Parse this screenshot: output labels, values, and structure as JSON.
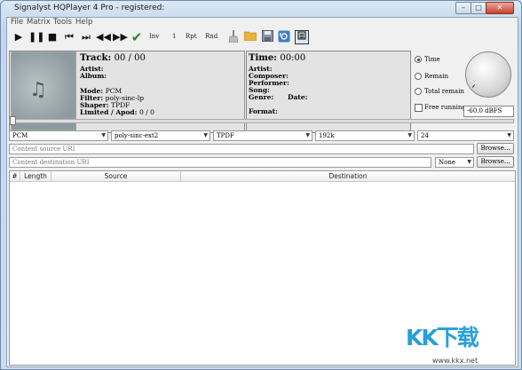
{
  "window": {
    "title": "Signalyst HQPlayer 4 Pro - registered:",
    "minimize": "–",
    "maximize": "□",
    "close": "✕"
  },
  "menu": [
    "File",
    "Matrix",
    "Tools",
    "Help"
  ],
  "toolbar": {
    "inv": "Inv",
    "one": "1",
    "rpt": "Rpt",
    "rnd": "Rnd",
    "icons": [
      "play-icon",
      "pause-icon",
      "stop-icon",
      "skip-back-icon",
      "skip-forward-icon",
      "rewind-icon",
      "fast-forward-icon",
      "check-icon",
      "broom-icon",
      "folder-icon",
      "save-icon",
      "refresh-icon",
      "menu-icon"
    ]
  },
  "track": {
    "label": "Track:",
    "value": "00 / 00",
    "artist": "Artist:",
    "album": "Album:",
    "mode_l": "Mode:",
    "mode_v": "PCM",
    "filter_l": "Filter:",
    "filter_v": "poly-sinc-lp",
    "shaper_l": "Shaper:",
    "shaper_v": "TPDF",
    "limited_l": "Limited / Apod:",
    "limited_v": "0 / 0"
  },
  "time": {
    "label": "Time:",
    "value": "00:00",
    "artist": "Artist:",
    "composer": "Composer:",
    "performer": "Performer:",
    "song": "Song:",
    "genre": "Genre:",
    "date": "Date:",
    "format": "Format:"
  },
  "display": {
    "time": "Time",
    "remain": "Remain",
    "total_remain": "Total remain",
    "free_running": "Free running"
  },
  "volume": "-60.0 dBFS",
  "settings": {
    "mode": "PCM",
    "filter": "poly-sinc-ext2",
    "shaper": "TPDF",
    "rate": "192k",
    "bits": "24",
    "source_placeholder": "Content source URI",
    "dest_placeholder": "Content destination URI",
    "dest_type": "None",
    "browse": "Browse..."
  },
  "table": {
    "columns": [
      "#",
      "Length",
      "Source",
      "Destination"
    ]
  },
  "watermark": {
    "logo": "KK下载",
    "url": "www.kkx.net"
  }
}
